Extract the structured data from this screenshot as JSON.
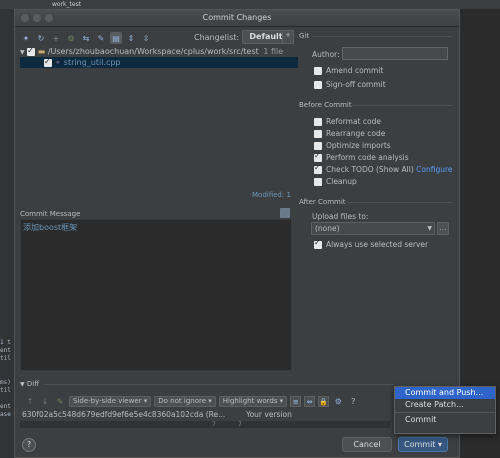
{
  "ide": {
    "run_config": "work_test"
  },
  "dialog": {
    "title": "Commit Changes",
    "changelist_label": "Changelist:",
    "changelist_value": "Default",
    "tree": {
      "root_path": "/Users/zhoubaochuan/Workspace/cplus/work/src/test",
      "root_count": "1 file",
      "file": "string_util.cpp"
    },
    "modified": "Modified: 1",
    "commit_message_label": "Commit Message",
    "commit_message": "添加boost框架",
    "git": {
      "section": "Git",
      "author_label": "Author:",
      "amend": "Amend commit",
      "signoff": "Sign-off commit"
    },
    "before_commit": {
      "section": "Before Commit",
      "reformat": "Reformat code",
      "rearrange": "Rearrange code",
      "optimize": "Optimize imports",
      "analysis": "Perform code analysis",
      "todo": "Check TODO (Show All)",
      "configure": "Configure",
      "cleanup": "Cleanup"
    },
    "after_commit": {
      "section": "After Commit",
      "upload_label": "Upload files to:",
      "upload_value": "(none)",
      "always_use": "Always use selected server"
    },
    "diff": {
      "label": "Diff",
      "viewer": "Side-by-side viewer",
      "ignore": "Do not ignore",
      "highlight": "Highlight words",
      "left_title": "630f02a5c548d679edfd9ef6e5e4c8360a102cda (Re...",
      "right_title": "Your version",
      "scroll_num": "7"
    },
    "buttons": {
      "help": "?",
      "cancel": "Cancel",
      "commit": "Commit"
    },
    "menu": {
      "commit_and_push": "Commit and Push...",
      "create_patch": "Create Patch...",
      "commit": "Commit"
    }
  }
}
